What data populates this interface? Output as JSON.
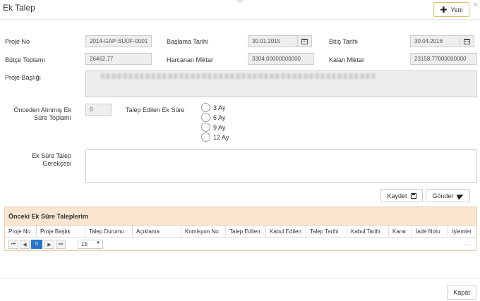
{
  "modal": {
    "title": "Ek Talep",
    "new_label": "Yeni",
    "close_glyph": "×"
  },
  "form": {
    "proje_no": {
      "label": "Proje No",
      "value": "2014-GAP-SUÜF-0001"
    },
    "baslama": {
      "label": "Başlama Tarihi",
      "value": "30.01.2015"
    },
    "bitis": {
      "label": "Bitiş Tarihi",
      "value": "30.04.2016"
    },
    "butce": {
      "label": "Bütçe Toplamı",
      "value": "26462,77"
    },
    "harcanan": {
      "label": "Harcanan Miktar",
      "value": "3304,00000000000"
    },
    "kalan": {
      "label": "Kalan Miktar",
      "value": "23158,77000000000"
    },
    "proje_basligi": {
      "label": "Proje Başlığı"
    },
    "onceden": {
      "label_line1": "Önceden Alınmış Ek",
      "label_line2": "Süre Toplamı",
      "value": "0"
    },
    "talep_edilen": {
      "label": "Talep Edilen Ek Süre",
      "options": [
        "3 Ay",
        "6 Ay",
        "9 Ay",
        "12 Ay"
      ]
    },
    "gerekce": {
      "label_line1": "Ek Süre Talep",
      "label_line2": "Gerekçesi",
      "value": ""
    }
  },
  "actions": {
    "save_label": "Kaydet",
    "send_label": "Gönder"
  },
  "grid": {
    "title": "Önceki Ek Süre Taleplerim",
    "columns": [
      "Proje No",
      "Proje Başlık",
      "Talep Durumu",
      "Açıklama",
      "Komisyon No",
      "Talep Edilen",
      "Kabul Edilen",
      "Talep Tarihi",
      "Kabul Tarihi",
      "Karar",
      "İade Notu",
      "İşlemler"
    ],
    "pager": {
      "first": "⏮",
      "prev": "◀",
      "current": "0",
      "next": "▶",
      "last": "⏭",
      "page_size": "15",
      "dots": "..."
    }
  },
  "footer": {
    "close_label": "Kapat"
  }
}
